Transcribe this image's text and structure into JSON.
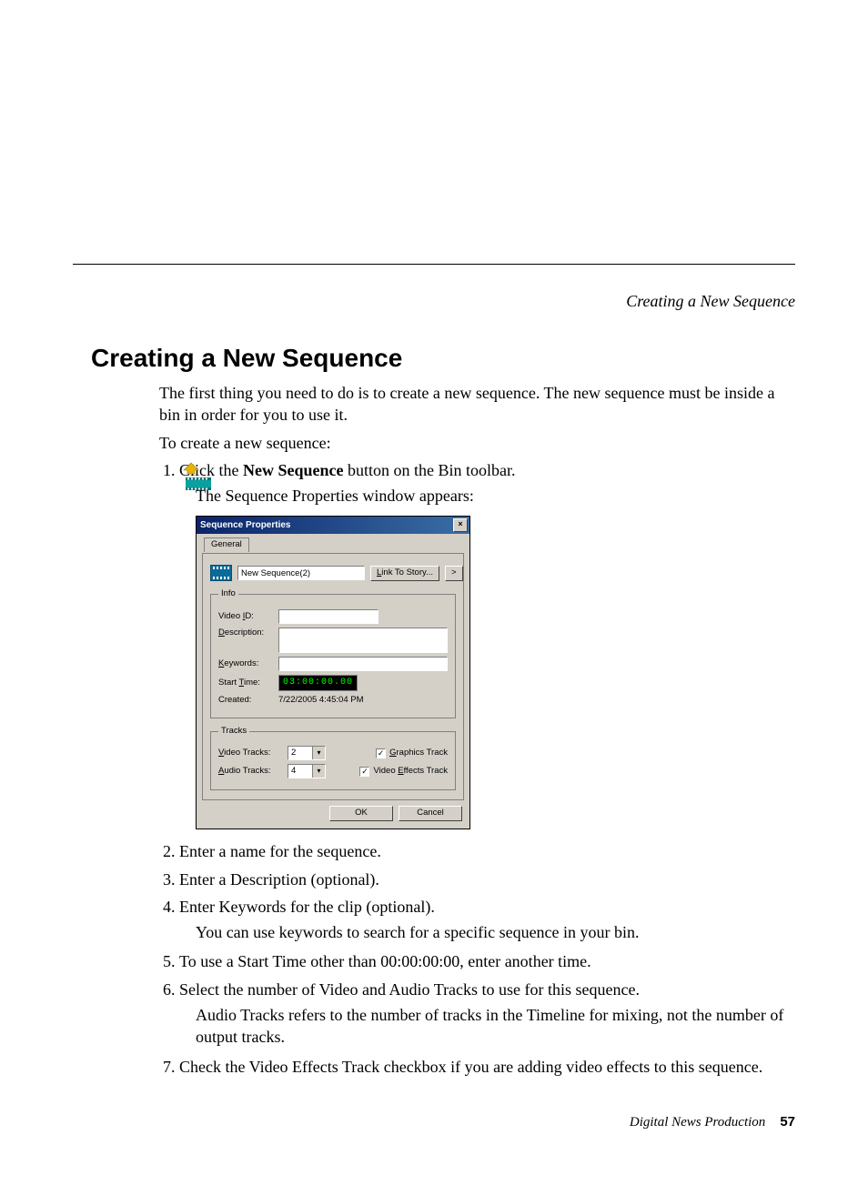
{
  "running_head": "Creating a New Sequence",
  "heading": "Creating a New Sequence",
  "intro": "The first thing you need to do is to create a new sequence. The new sequence must be inside a bin in order for you to use it.",
  "to_create": "To create a new sequence:",
  "steps": {
    "s1_prefix": "Click the ",
    "s1_bold": "New Sequence",
    "s1_suffix": " button on the Bin toolbar.",
    "s1_sub": "The Sequence Properties window appears:",
    "s2": "Enter a name for the sequence.",
    "s3": "Enter a Description (optional).",
    "s4": "Enter Keywords for the clip (optional).",
    "s4_sub": "You can use keywords to search for a specific sequence in your bin.",
    "s5": "To use a Start Time other than 00:00:00:00, enter another time.",
    "s6": "Select the number of Video and Audio Tracks to use for this sequence.",
    "s6_sub": "Audio Tracks refers to the number of tracks in the Timeline for mixing, not the number of output tracks.",
    "s7": "Check the Video Effects Track checkbox if you are adding video effects to this sequence."
  },
  "dialog": {
    "title": "Sequence Properties",
    "tab": "General",
    "name_value": "New Sequence(2)",
    "link_btn": "Link To Story...",
    "arrow_btn": ">",
    "info_legend": "Info",
    "video_id_label": "Video ID:",
    "description_label": "Description:",
    "keywords_label": "Keywords:",
    "start_time_label": "Start Time:",
    "start_time_value": "03:00:00.00",
    "created_label": "Created:",
    "created_value": "7/22/2005 4:45:04 PM",
    "tracks_legend": "Tracks",
    "video_tracks_label": "Video Tracks:",
    "video_tracks_value": "2",
    "audio_tracks_label": "Audio Tracks:",
    "audio_tracks_value": "4",
    "graphics_track_label": "Graphics Track",
    "video_effects_track_label": "Video Effects Track",
    "ok": "OK",
    "cancel": "Cancel"
  },
  "footer": {
    "book": "Digital News Production",
    "page": "57"
  }
}
